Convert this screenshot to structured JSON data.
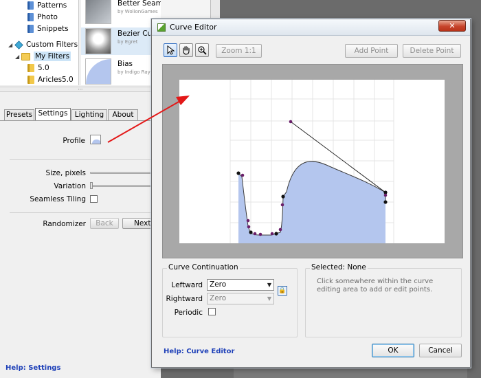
{
  "tree": {
    "items": [
      {
        "label": "Patterns",
        "icon": "book-icon"
      },
      {
        "label": "Photo",
        "icon": "book-icon"
      },
      {
        "label": "Snippets",
        "icon": "book-icon"
      },
      {
        "label": "Custom Filters",
        "icon": "cube-icon"
      },
      {
        "label": "My Filters",
        "icon": "folder-open-icon"
      },
      {
        "label": "5.0",
        "icon": "folder-icon"
      },
      {
        "label": "Aricles5.0",
        "icon": "folder-icon"
      }
    ]
  },
  "presets": [
    {
      "name": "Better Seamless",
      "author": "by WolionGames"
    },
    {
      "name": "Bezier Curve",
      "author": "by Egret"
    },
    {
      "name": "Bias",
      "author": "by Indigo Ray"
    }
  ],
  "settings": {
    "tabs": [
      "Presets",
      "Settings",
      "Lighting",
      "About"
    ],
    "active_tab": "Settings",
    "profile_label": "Profile",
    "size_label": "Size, pixels",
    "variation_label": "Variation",
    "seamless_label": "Seamless Tiling",
    "randomizer_label": "Randomizer",
    "back_label": "Back",
    "next_label": "Next V",
    "help_label": "Help: Settings"
  },
  "dialog": {
    "title": "Curve Editor",
    "close_glyph": "✕",
    "tools": [
      "pointer-icon",
      "hand-icon",
      "zoom-icon"
    ],
    "zoom_button": "Zoom 1:1",
    "add_point": "Add Point",
    "delete_point": "Delete Point",
    "continuation": {
      "title": "Curve Continuation",
      "leftward_label": "Leftward",
      "leftward_value": "Zero",
      "rightward_label": "Rightward",
      "rightward_value": "Zero",
      "periodic_label": "Periodic"
    },
    "selected": {
      "title": "Selected: None",
      "hint": "Click somewhere within the curve editing area to add or edit points."
    },
    "help": "Help: Curve Editor",
    "ok": "OK",
    "cancel": "Cancel"
  },
  "colors": {
    "curve_fill": "#b4c6ee",
    "point": "#6a1f6a",
    "arrow": "#e31818",
    "link": "#1e40b8"
  }
}
